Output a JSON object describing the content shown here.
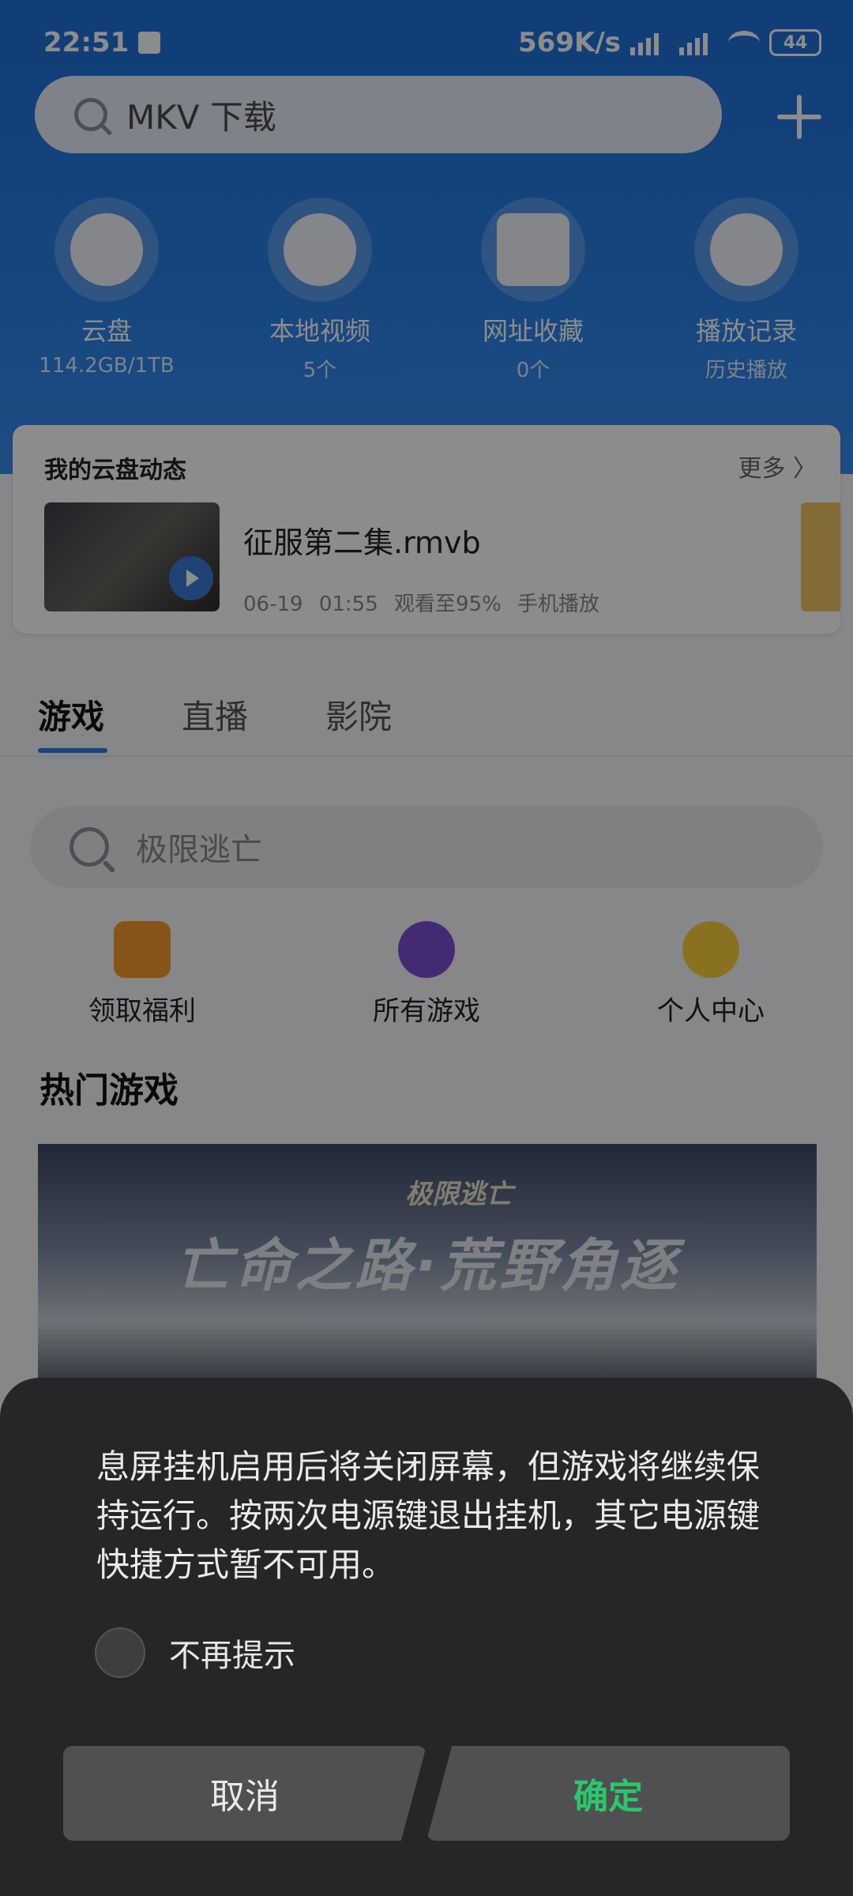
{
  "status_bar": {
    "time": "22:51",
    "speed": "569K/s",
    "battery": "44"
  },
  "header": {
    "search_placeholder": "MKV 下载"
  },
  "quick_actions": [
    {
      "label": "云盘",
      "sub": "114.2GB/1TB",
      "icon": "cloud-icon"
    },
    {
      "label": "本地视频",
      "sub": "5个",
      "icon": "play-icon"
    },
    {
      "label": "网址收藏",
      "sub": "0个",
      "icon": "folder-star-icon"
    },
    {
      "label": "播放记录",
      "sub": "历史播放",
      "icon": "clock-icon"
    }
  ],
  "cloud_card": {
    "title": "我的云盘动态",
    "more": "更多 〉",
    "file_name": "征服第二集.rmvb",
    "meta": "06-19 01:55 观看至95% 手机播放"
  },
  "tabs": [
    "游戏",
    "直播",
    "影院"
  ],
  "game_search_placeholder": "极限逃亡",
  "game_links": [
    {
      "label": "领取福利",
      "icon": "gift-icon"
    },
    {
      "label": "所有游戏",
      "icon": "gamepad-icon"
    },
    {
      "label": "个人中心",
      "icon": "smiley-icon"
    }
  ],
  "hot_games": {
    "title": "热门游戏",
    "banner_logo": "极限逃亡",
    "banner_title": "亡命之路·荒野角逐"
  },
  "dialog": {
    "message": "息屏挂机启用后将关闭屏幕，但游戏将继续保持运行。按两次电源键退出挂机，其它电源键快捷方式暂不可用。",
    "checkbox_label": "不再提示",
    "cancel": "取消",
    "confirm": "确定"
  },
  "colors": {
    "accent_blue": "#2f78e6",
    "confirm_green": "#29c96b"
  }
}
